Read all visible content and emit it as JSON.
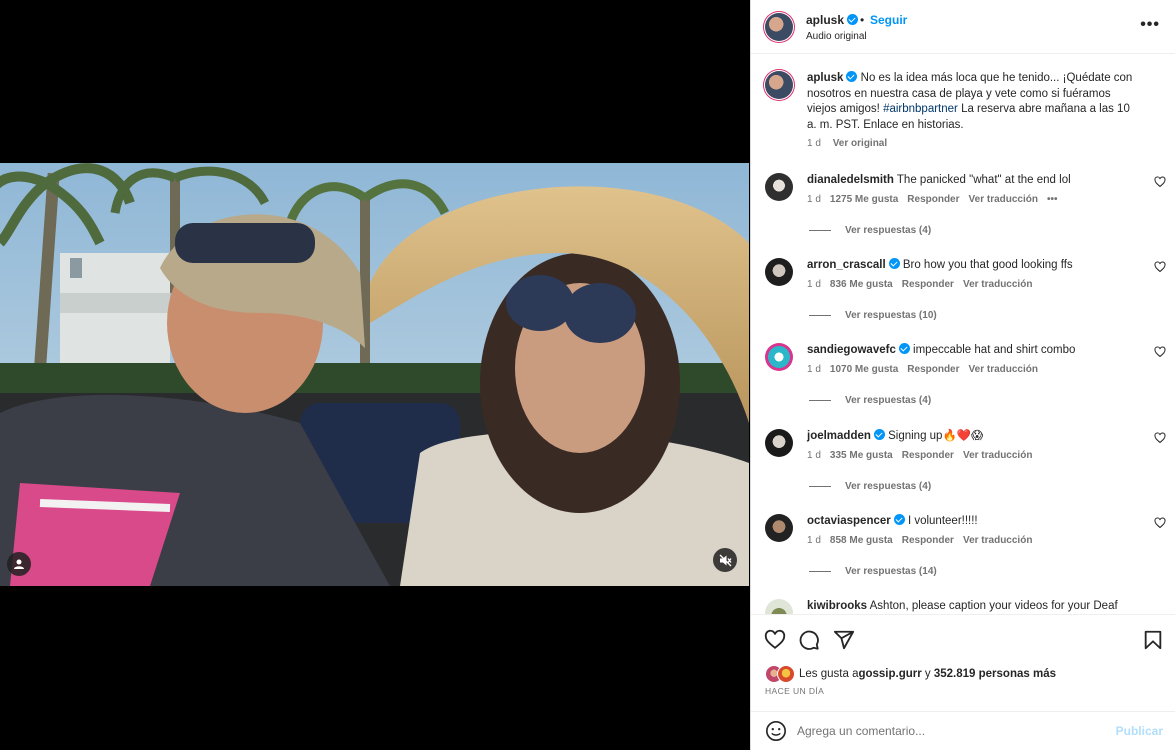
{
  "post": {
    "username": "aplusk",
    "separator": "•",
    "follow_label": "Seguir",
    "audio": "Audio original",
    "more_label": "•••"
  },
  "caption": {
    "username": "aplusk",
    "text_before": " No es la idea más loca que he tenido... ¡Quédate con nosotros en nuestra casa de playa y vete como si fuéramos viejos amigos! ",
    "hashtag": "#airbnbpartner",
    "text_after": " La reserva abre mañana a las 10 a. m. PST. Enlace en historias.",
    "time": "1 d",
    "translate": "Ver original"
  },
  "comments": [
    {
      "username": "dianaledelsmith",
      "verified": false,
      "text": " The panicked \"what\" at the end lol",
      "time": "1 d",
      "likes": "1275 Me gusta",
      "reply": "Responder",
      "translate": "Ver traducción",
      "more": "•••",
      "replies": "Ver respuestas (4)"
    },
    {
      "username": "arron_crascall",
      "verified": true,
      "text": " Bro how you that good looking ffs",
      "time": "1 d",
      "likes": "836 Me gusta",
      "reply": "Responder",
      "translate": "Ver traducción",
      "replies": "Ver respuestas (10)"
    },
    {
      "username": "sandiegowavefc",
      "verified": true,
      "text": " impeccable hat and shirt combo",
      "time": "1 d",
      "likes": "1070 Me gusta",
      "reply": "Responder",
      "translate": "Ver traducción",
      "replies": "Ver respuestas (4)"
    },
    {
      "username": "joelmadden",
      "verified": true,
      "text": " Signing up🔥❤️😱",
      "time": "1 d",
      "likes": "335 Me gusta",
      "reply": "Responder",
      "translate": "Ver traducción",
      "replies": "Ver respuestas (4)"
    },
    {
      "username": "octaviaspencer",
      "verified": true,
      "text": " I volunteer!!!!!",
      "time": "1 d",
      "likes": "858 Me gusta",
      "reply": "Responder",
      "translate": "Ver traducción",
      "replies": "Ver respuestas (14)"
    },
    {
      "username": "kiwibrooks",
      "verified": false,
      "text": " Ashton, please caption your videos for your Deaf"
    }
  ],
  "likes": {
    "prefix": "Les gusta a ",
    "user": "gossip.gurr",
    "middle": " y ",
    "count": "352.819 personas más"
  },
  "timestamp": "HACE UN DÍA",
  "add_comment": {
    "placeholder": "Agrega un comentario...",
    "publish_label": "Publicar"
  },
  "icons": {
    "tag": "user-tag-icon",
    "mute": "muted-speaker-icon",
    "like": "heart-icon",
    "comment": "comment-bubble-icon",
    "share": "paper-plane-icon",
    "save": "bookmark-icon",
    "emoji": "smiley-icon"
  },
  "colors": {
    "link": "#0095f6",
    "verified": "#0095f6",
    "muted_text": "#737373",
    "publish_disabled": "#b2dffc"
  }
}
